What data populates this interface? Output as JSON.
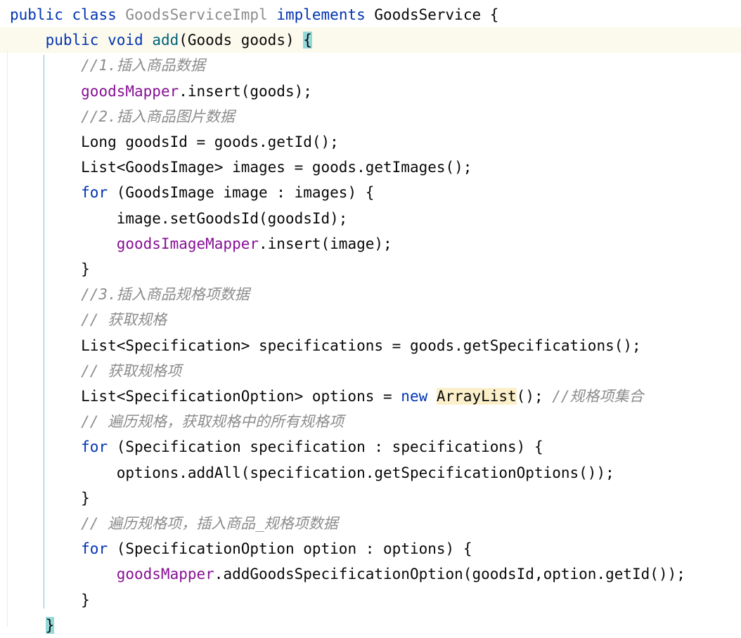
{
  "lines": [
    [
      [
        "kw",
        "public "
      ],
      [
        "kw",
        "class "
      ],
      [
        "cls-gray",
        "GoodsServiceImpl "
      ],
      [
        "kw",
        "implements "
      ],
      [
        "",
        "GoodsService {"
      ]
    ],
    [
      [
        "",
        "    "
      ],
      [
        "kw",
        "public "
      ],
      [
        "kw",
        "void "
      ],
      [
        "method-def",
        "add"
      ],
      [
        "",
        "(Goods goods) "
      ],
      [
        "brace-hl",
        "{"
      ]
    ],
    [
      [
        "comment",
        "        //1.插入商品数据"
      ]
    ],
    [
      [
        "",
        "        "
      ],
      [
        "field",
        "goodsMapper"
      ],
      [
        "",
        ".insert(goods);"
      ]
    ],
    [
      [
        "comment",
        "        //2.插入商品图片数据"
      ]
    ],
    [
      [
        "",
        "        Long goodsId = goods.getId();"
      ]
    ],
    [
      [
        "",
        "        List<GoodsImage> images = goods.getImages();"
      ]
    ],
    [
      [
        "",
        "        "
      ],
      [
        "kw",
        "for "
      ],
      [
        "",
        "(GoodsImage image : images) {"
      ]
    ],
    [
      [
        "",
        "            image.setGoodsId(goodsId);"
      ]
    ],
    [
      [
        "",
        "            "
      ],
      [
        "field",
        "goodsImageMapper"
      ],
      [
        "",
        ".insert(image);"
      ]
    ],
    [
      [
        "",
        "        }"
      ]
    ],
    [
      [
        "comment",
        "        //3.插入商品规格项数据"
      ]
    ],
    [
      [
        "comment",
        "        // 获取规格"
      ]
    ],
    [
      [
        "",
        "        List<Specification> specifications = goods.getSpecifications();"
      ]
    ],
    [
      [
        "comment",
        "        // 获取规格项"
      ]
    ],
    [
      [
        "",
        "        List<SpecificationOption> options = "
      ],
      [
        "kw",
        "new "
      ],
      [
        "unresolved",
        "ArrayList"
      ],
      [
        "",
        "(); "
      ],
      [
        "comment",
        "//规格项集合"
      ]
    ],
    [
      [
        "comment",
        "        // 遍历规格，获取规格中的所有规格项"
      ]
    ],
    [
      [
        "",
        "        "
      ],
      [
        "kw",
        "for "
      ],
      [
        "",
        "(Specification specification : specifications) {"
      ]
    ],
    [
      [
        "",
        "            options.addAll(specification.getSpecificationOptions());"
      ]
    ],
    [
      [
        "",
        "        }"
      ]
    ],
    [
      [
        "comment",
        "        // 遍历规格项，插入商品_规格项数据"
      ]
    ],
    [
      [
        "",
        "        "
      ],
      [
        "kw",
        "for "
      ],
      [
        "",
        "(SpecificationOption option : options) {"
      ]
    ],
    [
      [
        "",
        "            "
      ],
      [
        "field",
        "goodsMapper"
      ],
      [
        "",
        ".addGoodsSpecificationOption(goodsId,option.getId());"
      ]
    ],
    [
      [
        "",
        "        }"
      ]
    ],
    [
      [
        "",
        "    "
      ],
      [
        "brace-hl",
        "}"
      ]
    ]
  ]
}
